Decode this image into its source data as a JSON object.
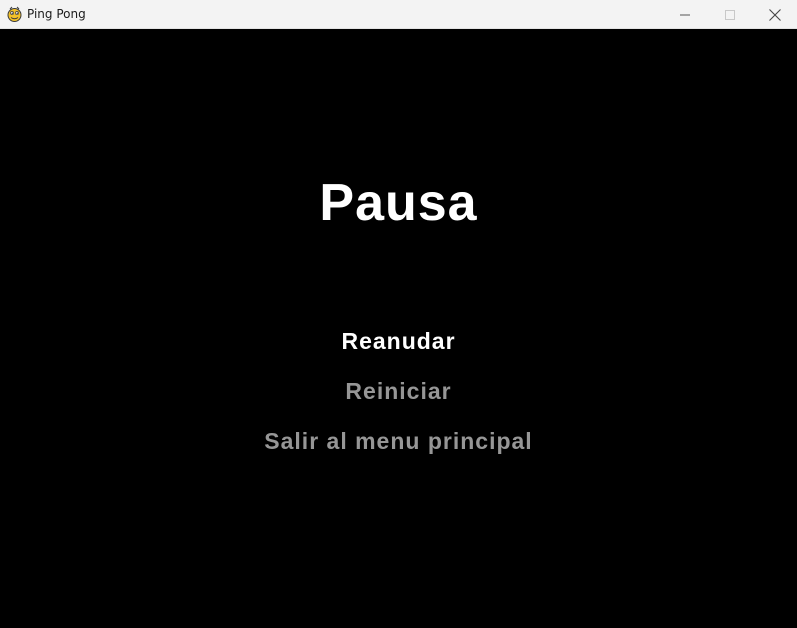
{
  "window": {
    "title": "Ping Pong",
    "icon": "pygame-snake-icon",
    "controls": {
      "minimize_icon": "minimize-icon",
      "maximize_icon": "maximize-icon",
      "close_icon": "close-icon"
    }
  },
  "pause_menu": {
    "title": "Pausa",
    "selected_index": 0,
    "items": [
      {
        "label": "Reanudar"
      },
      {
        "label": "Reiniciar"
      },
      {
        "label": "Salir al menu principal"
      }
    ]
  },
  "colors": {
    "background": "#000000",
    "title_text": "#ffffff",
    "selected_item": "#ffffff",
    "unselected_item": "#969696",
    "titlebar_bg": "#f3f3f3"
  }
}
